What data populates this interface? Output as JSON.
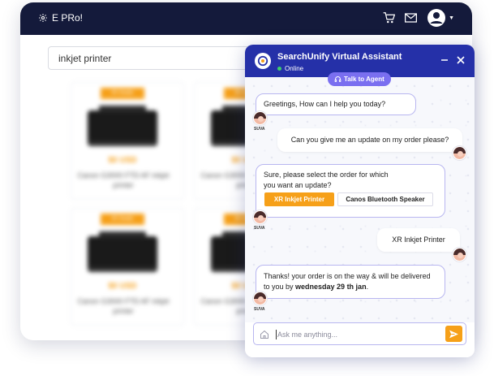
{
  "shop": {
    "brand": "E PRo!",
    "search_value": "inkjet printer",
    "products": [
      {
        "badge": "IR Deals",
        "price": "$0 USD",
        "name": "Canon G3000 FTD AF inkjet printer"
      },
      {
        "badge": "IR Deals",
        "price": "$0 USD",
        "name": "Canon G3000 FTD AF inkjet printer"
      },
      {
        "badge": "IR Deals",
        "price": "$0 USD",
        "name": "Canon G3000 FTD AF inkjet printer"
      },
      {
        "badge": "IR Deals",
        "price": "$0 USD",
        "name": "Canon G3000 FTD AF inkjet printer"
      }
    ]
  },
  "chat": {
    "title": "SearchUnify Virtual Assistant",
    "status": "Online",
    "talk_to_agent": "Talk to Agent",
    "bot_name": "SUVA",
    "messages": {
      "m1": "Greetings, How can I help you today?",
      "m2": "Can you give me an update on my order please?",
      "m3": "Sure, please select the order for which you want an update?",
      "opt1": "XR Inkjet Printer",
      "opt2": "Canos Bluetooth Speaker",
      "m4": "XR Inkjet Printer",
      "m5_prefix": "Thanks! your order is on the way & will be delivered to you by ",
      "m5_bold": "wednesday 29 th jan",
      "m5_suffix": "."
    },
    "input_placeholder": "Ask me anything..."
  },
  "colors": {
    "header_dark": "#141a3b",
    "chat_header": "#2530a8",
    "accent_orange": "#f6a019",
    "agent_purple": "#7a6ff0",
    "online_green": "#3ecf6a"
  },
  "icons": [
    "gear-icon",
    "cart-icon",
    "mail-icon",
    "user-avatar-icon",
    "minimize-icon",
    "close-icon",
    "headset-icon",
    "home-icon",
    "send-icon"
  ]
}
